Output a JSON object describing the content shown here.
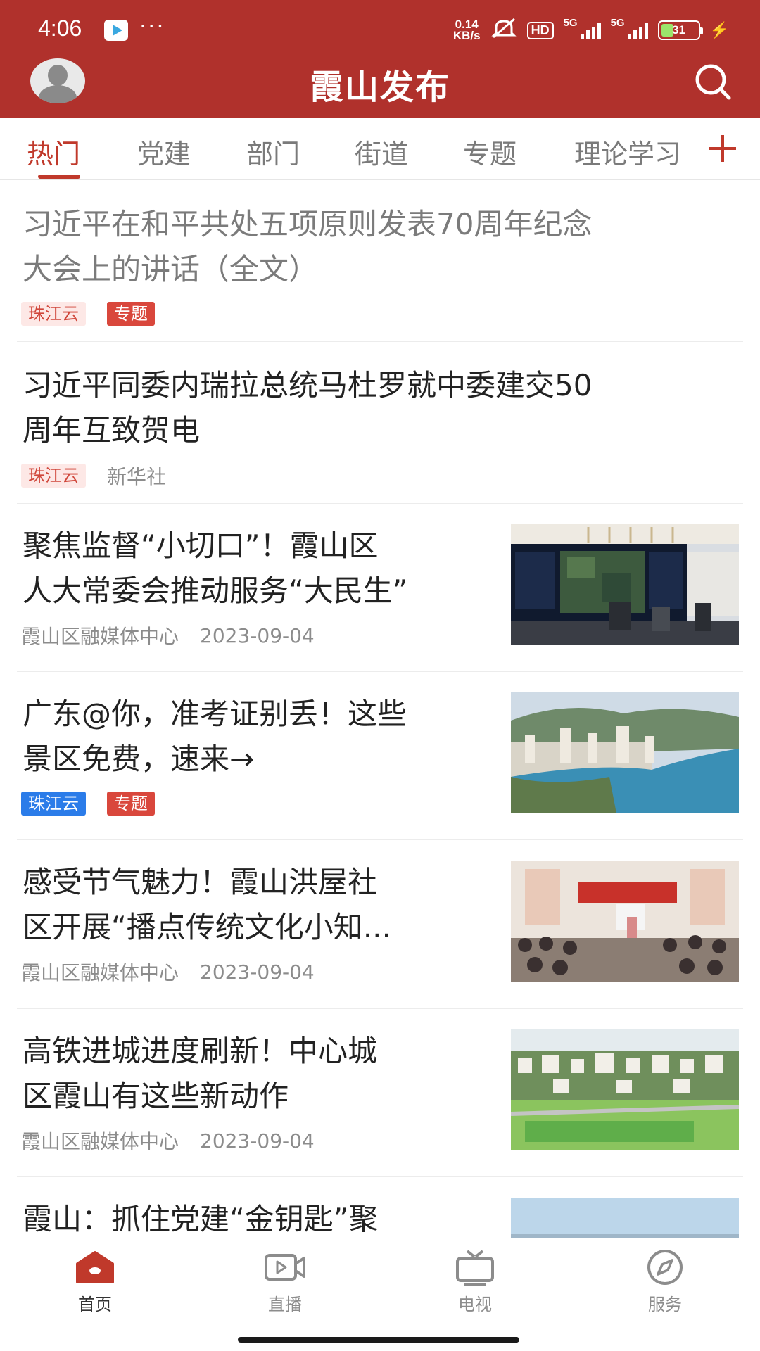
{
  "status_bar": {
    "time": "4:06",
    "net_speed_value": "0.14",
    "net_speed_unit": "KB/s",
    "hd_label": "HD",
    "signal1_label": "5G",
    "signal2_label": "5G",
    "battery_level": "31",
    "icons": [
      "media-app-icon",
      "more-dots-icon",
      "mute-icon",
      "signal-icon",
      "battery-icon",
      "charging-icon"
    ]
  },
  "app_bar": {
    "title": "霞山发布",
    "avatar_icon": "user-avatar-icon",
    "search_icon": "search-icon",
    "color": "#b0312c"
  },
  "tabs": {
    "items": [
      "热门",
      "党建",
      "部门",
      "街道",
      "专题",
      "理论学习"
    ],
    "active_index": 0,
    "add_icon": "plus-icon",
    "active_color": "#c0392b"
  },
  "feed": {
    "items": [
      {
        "title": "习近平在和平共处五项原则发表70周年纪念大会上的讲话（全文）",
        "title_line1": "习近平在和平共处五项原则发表70周年纪念",
        "title_line2": "大会上的讲话（全文）",
        "read": true,
        "tags": [
          "珠江云",
          "专题"
        ]
      },
      {
        "title": "习近平同委内瑞拉总统马杜罗就中委建交50周年互致贺电",
        "title_line1": "习近平同委内瑞拉总统马杜罗就中委建交50",
        "title_line2": "周年互致贺电",
        "tags": [
          "珠江云"
        ],
        "source": "新华社"
      },
      {
        "title_line1": "聚焦监督“小切口”！霞山区",
        "title_line2": "人大常委会推动服务“大民生”",
        "source": "霞山区融媒体中心",
        "date": "2023-09-04",
        "image": "command-center-photo"
      },
      {
        "title_line1": "广东@你，准考证别丢！这些",
        "title_line2": "景区免费，速来→",
        "tags": [
          "珠江云",
          "专题"
        ],
        "image": "coastal-city-photo"
      },
      {
        "title_line1": "感受节气魅力！霞山洪屋社",
        "title_line2": "区开展“播点传统文化小知...",
        "source": "霞山区融媒体中心",
        "date": "2023-09-04",
        "image": "classroom-event-photo"
      },
      {
        "title_line1": "高铁进城进度刷新！中心城",
        "title_line2": "区霞山有这些新动作",
        "source": "霞山区融媒体中心",
        "date": "2023-09-04",
        "image": "aerial-town-photo"
      },
      {
        "title_line1": "霞山：抓住党建“金钥匙”聚",
        "image": "skyline-photo"
      }
    ]
  },
  "bottom_nav": {
    "items": [
      {
        "label": "首页",
        "icon": "home-icon",
        "active": true
      },
      {
        "label": "直播",
        "icon": "live-video-icon"
      },
      {
        "label": "电视",
        "icon": "tv-icon"
      },
      {
        "label": "服务",
        "icon": "compass-icon"
      }
    ]
  }
}
